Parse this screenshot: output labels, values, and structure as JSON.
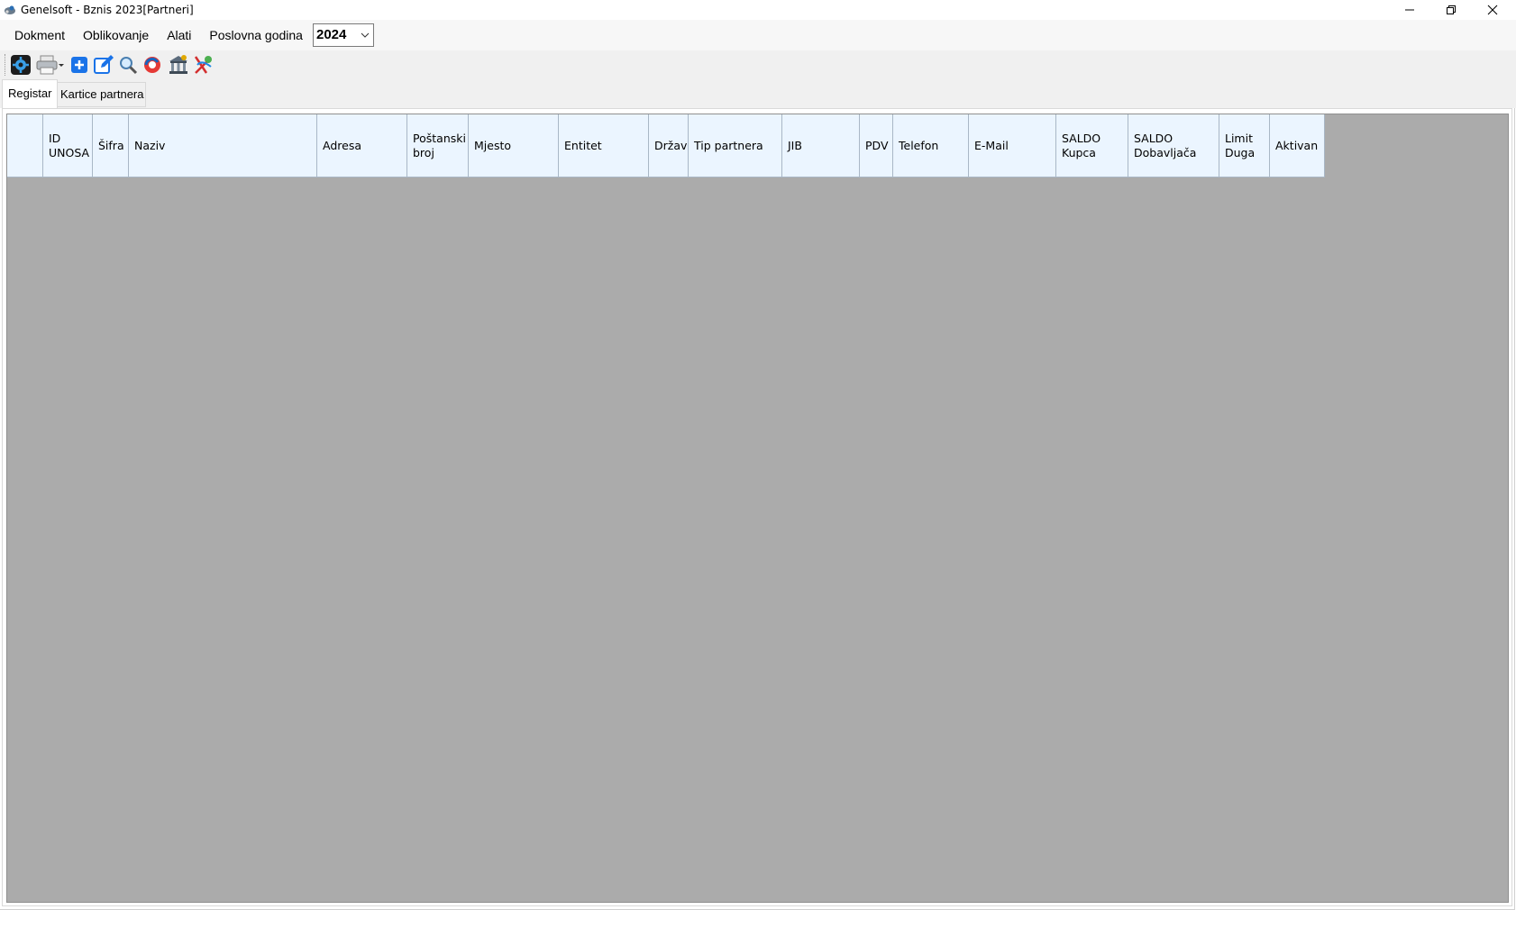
{
  "window": {
    "title": "Genelsoft - Bznis 2023[Partneri]",
    "controls": {
      "minimize": "minimize-icon",
      "restore": "restore-icon",
      "close": "close-icon"
    }
  },
  "menu": {
    "items": [
      {
        "label": "Dokment"
      },
      {
        "label": "Oblikovanje"
      },
      {
        "label": "Alati"
      },
      {
        "label": "Poslovna godina"
      }
    ],
    "year_select": {
      "value": "2024"
    }
  },
  "toolbar": {
    "buttons": [
      {
        "icon": "settings-icon"
      },
      {
        "icon": "print-dropdown-icon"
      },
      {
        "icon": "add-icon"
      },
      {
        "icon": "edit-icon"
      },
      {
        "icon": "search-icon"
      },
      {
        "icon": "refresh-icon"
      },
      {
        "icon": "bank-icon"
      },
      {
        "icon": "exit-icon"
      }
    ]
  },
  "tabs": [
    {
      "label": "Registar",
      "active": true
    },
    {
      "label": "Kartice partnera",
      "active": false
    }
  ],
  "grid": {
    "columns": [
      {
        "label": ""
      },
      {
        "label": "ID\nUNOSA"
      },
      {
        "label": "Šifra"
      },
      {
        "label": "Naziv"
      },
      {
        "label": "Adresa"
      },
      {
        "label": "Poštanski\nbroj"
      },
      {
        "label": "Mjesto"
      },
      {
        "label": "Entitet"
      },
      {
        "label": "Država"
      },
      {
        "label": "Tip partnera"
      },
      {
        "label": "JIB"
      },
      {
        "label": "PDV"
      },
      {
        "label": "Telefon"
      },
      {
        "label": "E-Mail"
      },
      {
        "label": "SALDO\nKupca"
      },
      {
        "label": "SALDO\nDobavljača"
      },
      {
        "label": "Limit\nDuga"
      },
      {
        "label": "Aktivan"
      }
    ],
    "rows": []
  }
}
